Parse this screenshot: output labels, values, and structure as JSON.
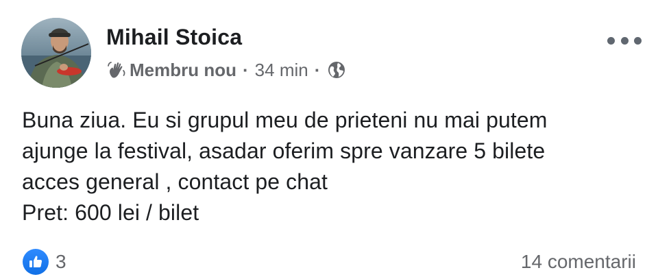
{
  "author": {
    "name": "Mihail Stoica"
  },
  "meta": {
    "badge_icon": "waving-hand-icon",
    "badge_label": "Membru nou",
    "separator": "·",
    "time": "34 min",
    "audience_icon": "globe-icon"
  },
  "post": {
    "lines": [
      "Buna ziua. Eu si grupul meu de prieteni nu mai putem",
      "ajunge la festival, asadar oferim spre vanzare 5 bilete",
      "acces general , contact pe chat",
      "Pret: 600 lei / bilet"
    ]
  },
  "footer": {
    "reaction_icon": "like-icon",
    "reaction_count": "3",
    "comments": "14 comentarii"
  },
  "colors": {
    "text_primary": "#1c1e21",
    "text_secondary": "#65676b",
    "like_blue": "#1877f2"
  }
}
